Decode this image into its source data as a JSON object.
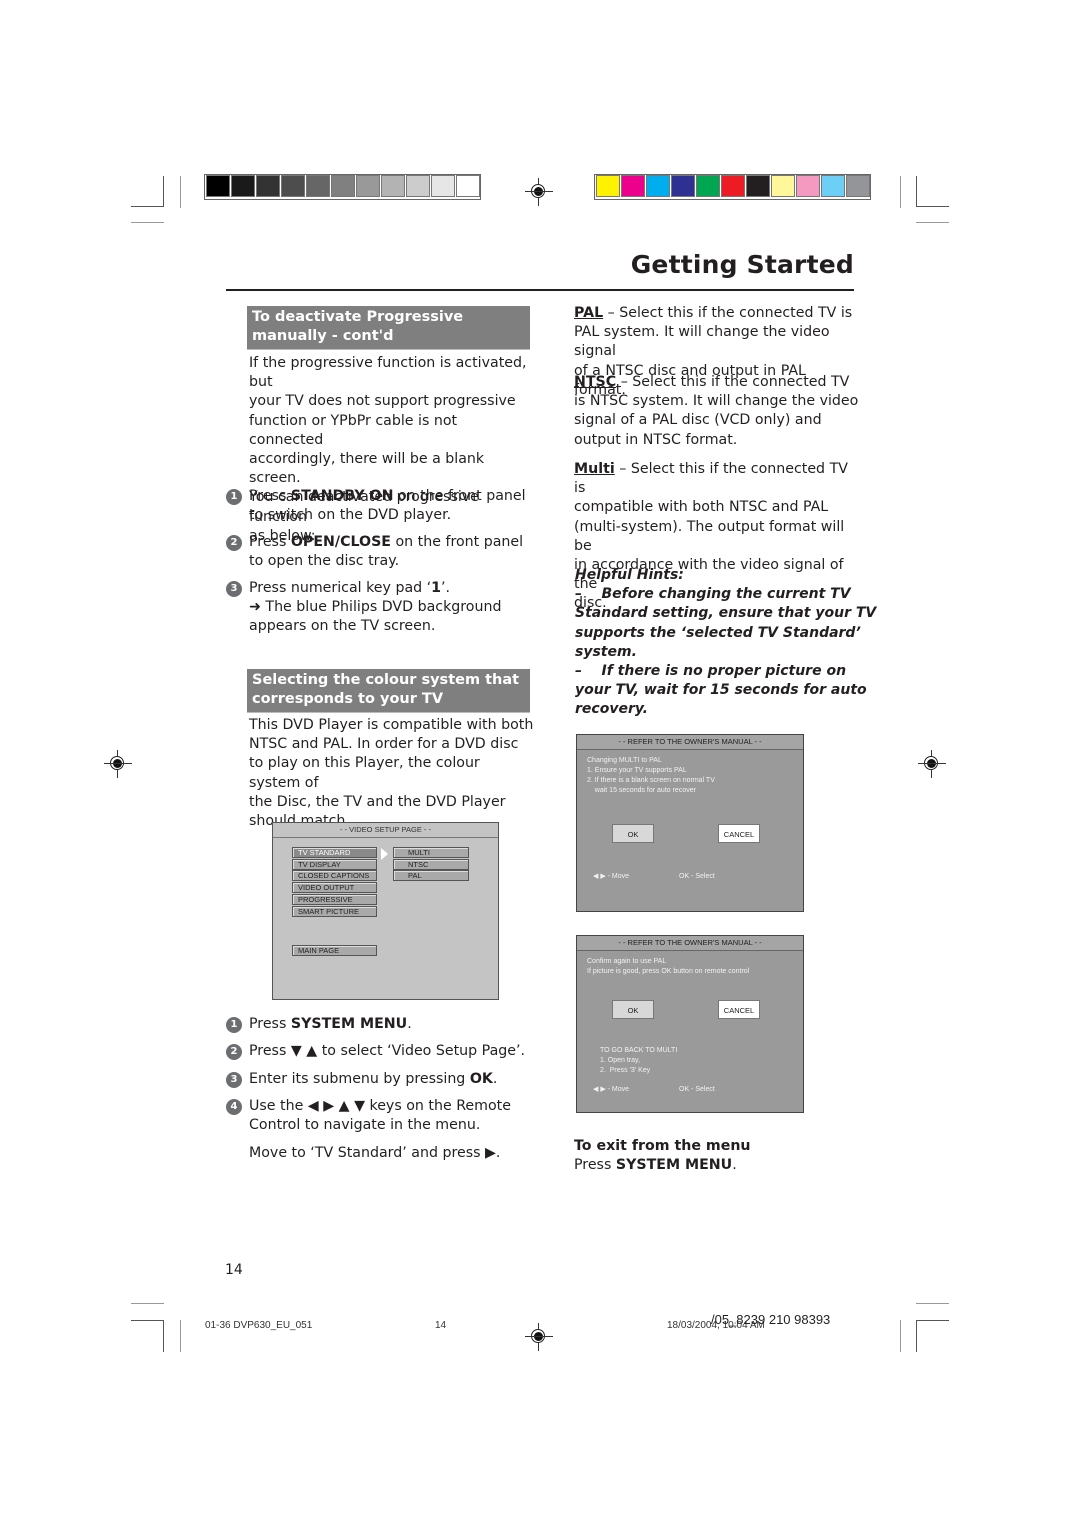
{
  "print_marks": {
    "grayscale_swatches": [
      "#000000",
      "#1a1a1a",
      "#333333",
      "#4d4d4d",
      "#666666",
      "#808080",
      "#999999",
      "#b3b3b3",
      "#cccccc",
      "#e6e6e6",
      "#ffffff"
    ],
    "color_swatches": [
      "#fff200",
      "#ec008c",
      "#00aeef",
      "#2e3192",
      "#00a651",
      "#ed1c24",
      "#231f20",
      "#fff799",
      "#f49ac1",
      "#6dcff6",
      "#939598"
    ]
  },
  "header": {
    "title": "Getting Started"
  },
  "left": {
    "section1": {
      "heading": "To deactivate Progressive manually - cont'd",
      "intro": [
        "If the progressive function is activated, but",
        "your TV does not support progressive",
        "function or YPbPr cable is not connected",
        "accordingly, there will be a blank screen.",
        "You can deactivated progressive function",
        "as below:"
      ],
      "steps": [
        {
          "num": "1",
          "lines": [
            "Press <b>STANDBY ON</b> on the front panel",
            "to switch on the DVD player."
          ]
        },
        {
          "num": "2",
          "lines": [
            "Press <b>OPEN/CLOSE</b> on the front panel",
            "to open the disc tray."
          ]
        },
        {
          "num": "3",
          "lines": [
            "Press numerical key pad ‘<b>1</b>’.",
            "➜ The blue Philips DVD background",
            "appears on the TV screen."
          ]
        }
      ]
    },
    "section2": {
      "heading": "Selecting the colour system that corresponds to your TV",
      "intro": [
        "This DVD Player is compatible with both",
        "NTSC and PAL. In order for a DVD disc",
        "to play on this Player, the colour system of",
        "the Disc, the TV and the DVD Player",
        "should match."
      ],
      "osd": {
        "header": "- - VIDEO SETUP PAGE - -",
        "menu_items": [
          "TV STANDARD",
          "TV DISPLAY",
          "CLOSED CAPTIONS",
          "VIDEO OUTPUT",
          "PROGRESSIVE",
          "SMART PICTURE"
        ],
        "selected_item": "TV STANDARD",
        "options": [
          "MULTI",
          "NTSC",
          "PAL"
        ],
        "main_page": "MAIN PAGE"
      },
      "steps": [
        {
          "num": "1",
          "lines": [
            "Press <b>SYSTEM MENU</b>."
          ]
        },
        {
          "num": "2",
          "lines": [
            "Press ▼ ▲ to select ‘Video Setup Page’."
          ]
        },
        {
          "num": "3",
          "lines": [
            "Enter its submenu by pressing <b>OK</b>."
          ]
        },
        {
          "num": "4",
          "lines": [
            "Use the ◀ ▶ ▲ ▼ keys on the Remote",
            "Control to navigate in the menu."
          ]
        }
      ],
      "move_note": "Move to ‘TV Standard’ and press ▶."
    }
  },
  "right": {
    "options": [
      {
        "label": "PAL",
        "lines": [
          " – Select this if the connected TV is",
          "PAL system. It will change the video signal",
          "of a NTSC disc and output in PAL format."
        ]
      },
      {
        "label": "NTSC",
        "lines": [
          " – Select this if the connected TV",
          "is NTSC system. It will change the video",
          "signal of a PAL disc (VCD only) and",
          "output in NTSC format."
        ]
      },
      {
        "label": "Multi",
        "lines": [
          " – Select this if the connected TV is",
          "compatible with both NTSC and PAL",
          "(multi-system). The output format will be",
          "in accordance with the video signal of the",
          "disc."
        ]
      }
    ],
    "hints": {
      "title": "Helpful Hints:",
      "items": [
        [
          "–    Before changing the current TV",
          "Standard setting, ensure that your TV",
          "supports the ‘selected TV Standard’",
          "system."
        ],
        [
          "–    If there is no proper picture on",
          "your TV, wait for 15 seconds for auto",
          "recovery."
        ]
      ]
    },
    "osd1": {
      "header": "- - REFER TO THE OWNER'S MANUAL - -",
      "lines": [
        "Changing MULTI to PAL",
        "1. Ensure your TV supports PAL",
        "2. If there is a blank screen on normal TV",
        "    wait 15 seconds for auto recover"
      ],
      "ok": "OK",
      "cancel": "CANCEL",
      "move": "◀ ▶  - Move",
      "select": "OK - Select"
    },
    "osd2": {
      "header": "- - REFER TO THE OWNER'S MANUAL - -",
      "lines": [
        "Confirm again to use PAL",
        "If picture is good, press OK button on remote control"
      ],
      "ok": "OK",
      "cancel": "CANCEL",
      "back_lines": [
        "TO GO BACK TO MULTI",
        "1. Open tray,",
        "2.  Press '3' Key"
      ],
      "move": "◀ ▶  - Move",
      "select": "OK - Select"
    },
    "exit": {
      "title": "To exit from the menu",
      "line": "Press <b>SYSTEM MENU</b>."
    }
  },
  "footer": {
    "page_number": "14",
    "file_name": "01-36 DVP630_EU_051",
    "sheet_number": "14",
    "date": "18/03/2004, 10:04 AM",
    "code": "/05_8239 210 98393"
  }
}
